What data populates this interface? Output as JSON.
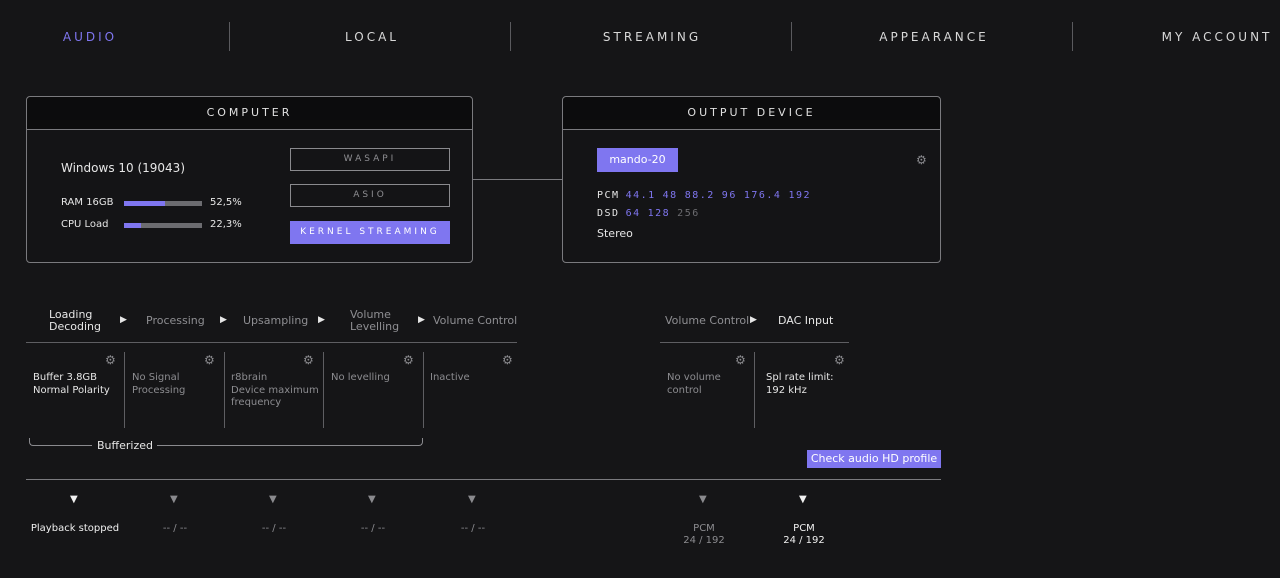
{
  "nav": {
    "items": [
      {
        "label": "AUDIO",
        "active": true
      },
      {
        "label": "LOCAL",
        "active": false
      },
      {
        "label": "STREAMING",
        "active": false
      },
      {
        "label": "APPEARANCE",
        "active": false
      },
      {
        "label": "MY ACCOUNT",
        "active": false
      }
    ]
  },
  "computer": {
    "title": "COMPUTER",
    "os": "Windows 10 (19043)",
    "ram": {
      "label": "RAM 16GB",
      "value": "52,5%",
      "fraction": 0.525
    },
    "cpu": {
      "label": "CPU Load",
      "value": "22,3%",
      "fraction": 0.223
    },
    "modes": [
      {
        "label": "WASAPI",
        "active": false
      },
      {
        "label": "ASIO",
        "active": false
      },
      {
        "label": "KERNEL STREAMING",
        "active": true
      }
    ]
  },
  "output": {
    "title": "OUTPUT DEVICE",
    "device": "mando-20",
    "pcm_label": "PCM",
    "pcm_rates": [
      {
        "v": "44.1",
        "on": true
      },
      {
        "v": "48",
        "on": true
      },
      {
        "v": "88.2",
        "on": true
      },
      {
        "v": "96",
        "on": true
      },
      {
        "v": "176.4",
        "on": true
      },
      {
        "v": "192",
        "on": true
      }
    ],
    "dsd_label": "DSD",
    "dsd_rates": [
      {
        "v": "64",
        "on": true
      },
      {
        "v": "128",
        "on": true
      },
      {
        "v": "256",
        "on": false
      }
    ],
    "channels": "Stereo"
  },
  "pipeline": {
    "stages": {
      "loading": "Loading",
      "decoding": "Decoding",
      "processing": "Processing",
      "upsampling": "Upsampling",
      "volume_levelling_1": "Volume",
      "volume_levelling_2": "Levelling",
      "volume_control": "Volume Control"
    },
    "cells": {
      "buffer_1": "Buffer 3.8GB",
      "buffer_2": "Normal Polarity",
      "processing_1": "No Signal",
      "processing_2": "Processing",
      "upsampling_1": "r8brain",
      "upsampling_2": "Device maximum",
      "upsampling_3": "frequency",
      "levelling": "No levelling",
      "volume_control": "Inactive"
    },
    "bufferized": "Bufferized",
    "statuses": {
      "playback": "Playback stopped",
      "s2": "-- / --",
      "s3": "-- / --",
      "s4": "-- / --",
      "s5": "-- / --"
    }
  },
  "device_chain": {
    "stages": {
      "volume_control": "Volume Control",
      "dac_input": "DAC Input"
    },
    "cells": {
      "volume_1": "No volume",
      "volume_2": "control",
      "rate_1": "Spl rate limit:",
      "rate_2": "192 kHz"
    },
    "check_button": "Check audio HD profile",
    "statuses": {
      "vol_format": "PCM",
      "vol_rate": "24 / 192",
      "dac_format": "PCM",
      "dac_rate": "24 / 192"
    }
  },
  "colors": {
    "accent": "#7f76f0",
    "background": "#151517",
    "muted": "#8c8c90"
  },
  "icons": {
    "settings": "gear-icon",
    "arrow": "play-arrow-icon",
    "marker": "triangle-down-icon"
  }
}
